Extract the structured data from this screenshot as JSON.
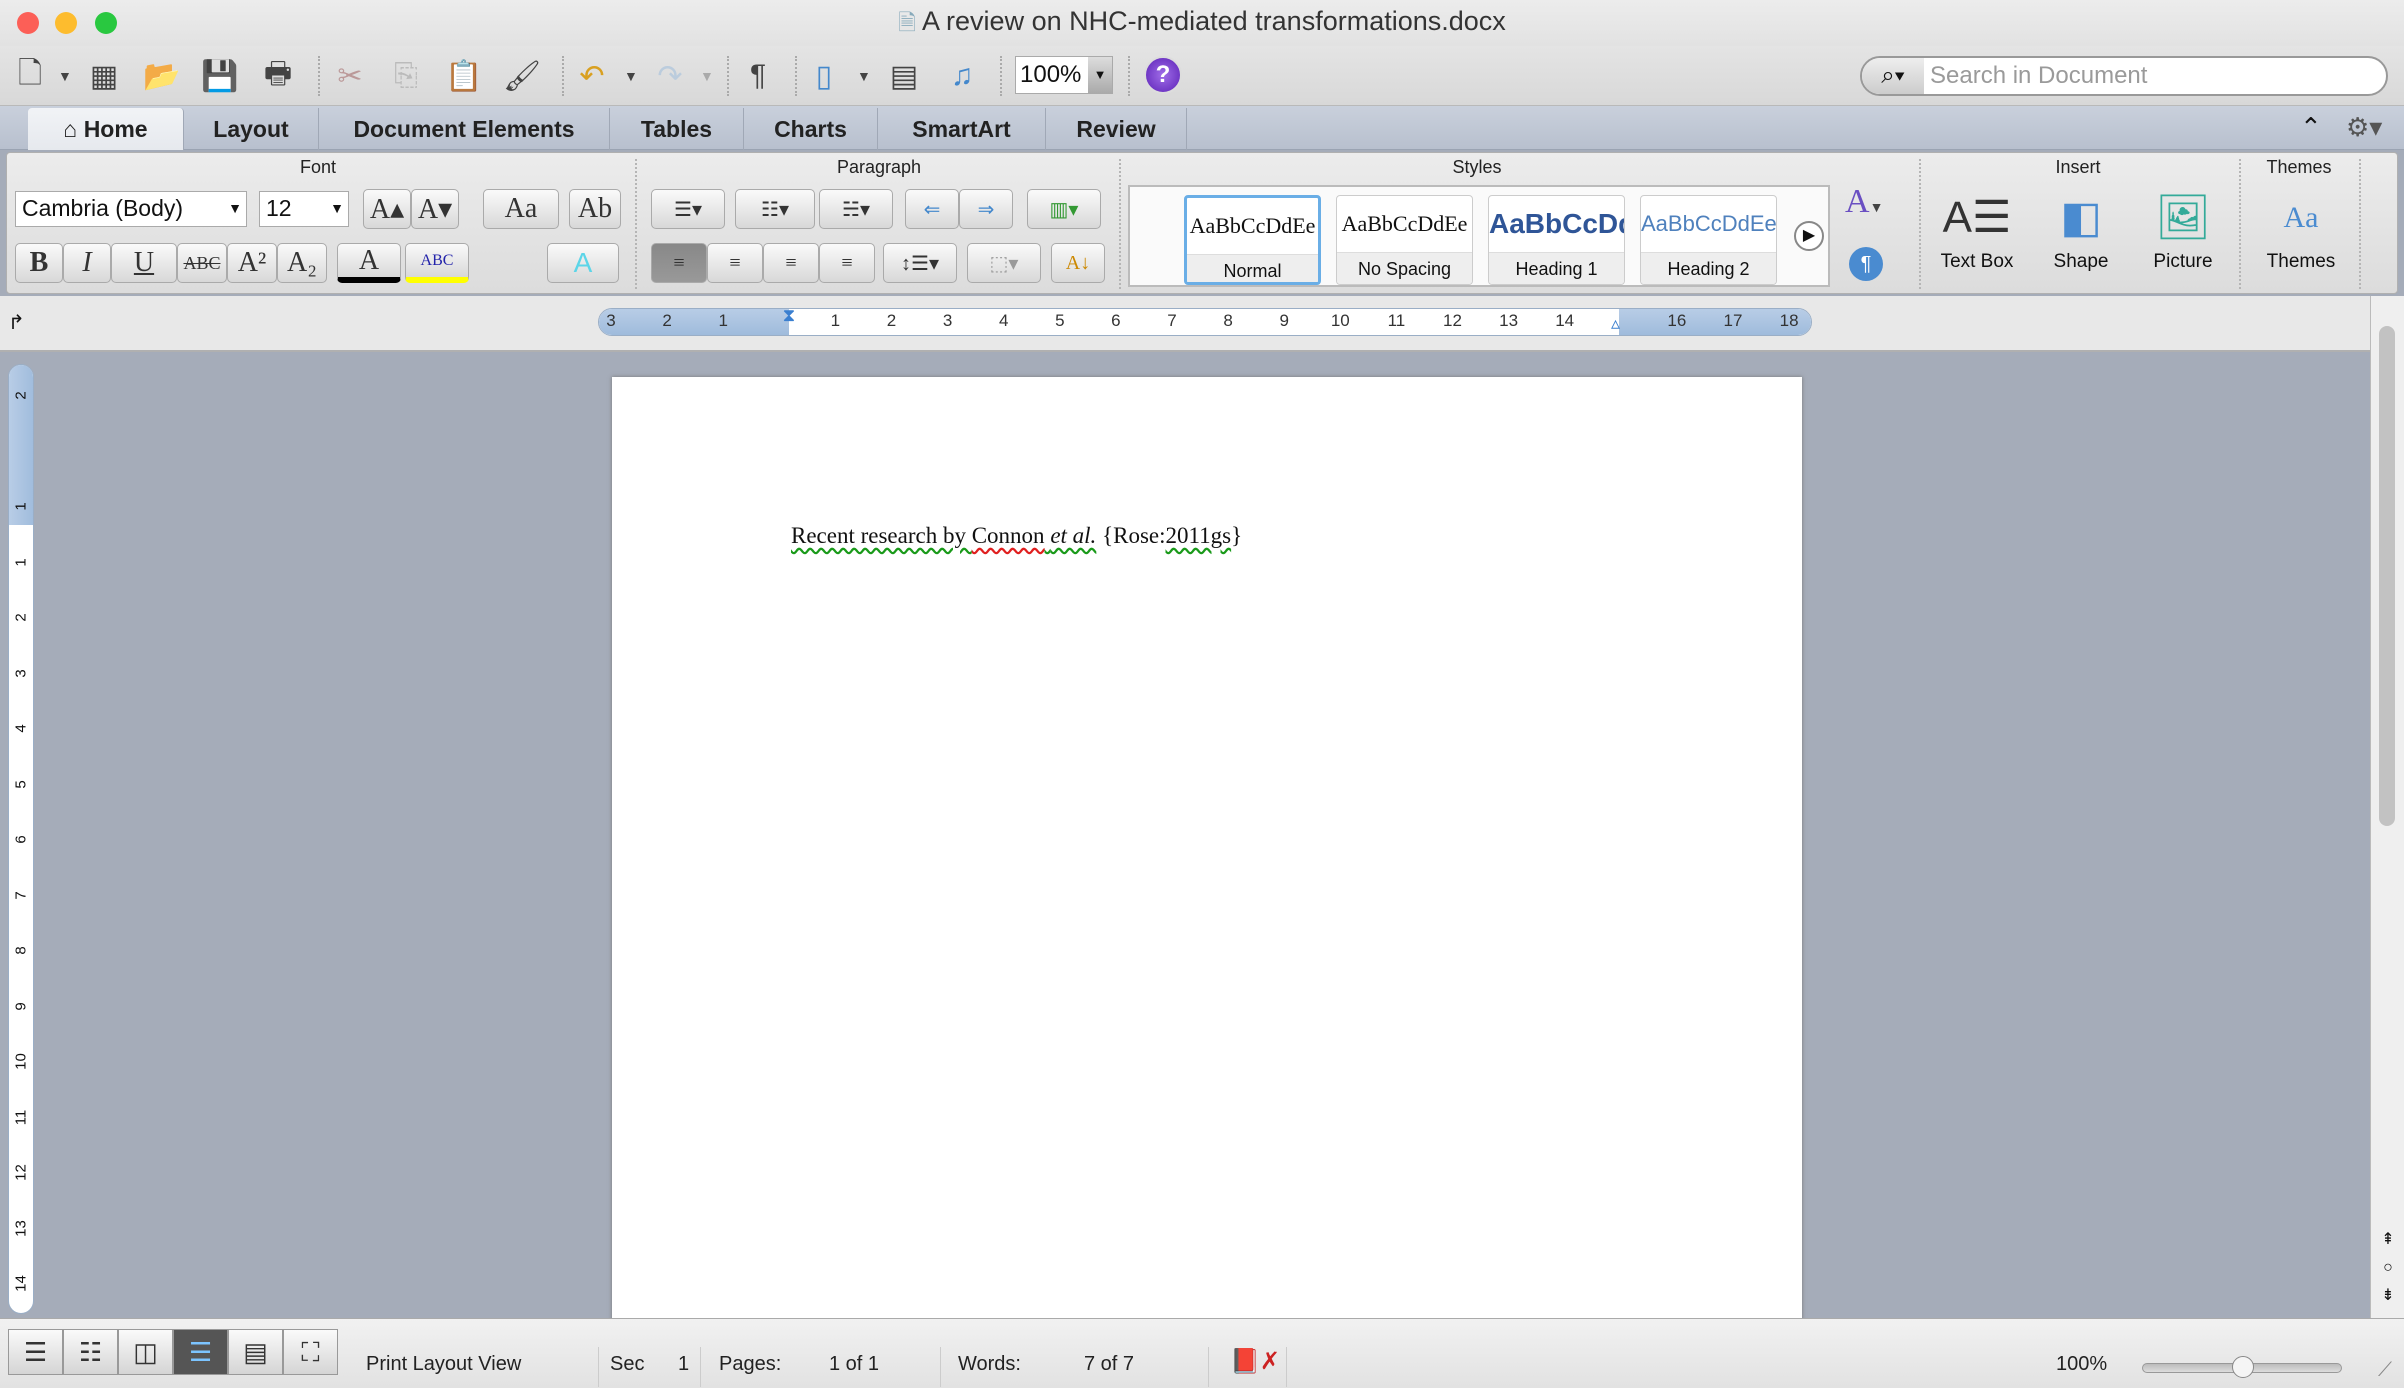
{
  "window": {
    "title": "A review on NHC-mediated transformations.docx"
  },
  "toolbar": {
    "zoom": "100%",
    "help": "?",
    "search_placeholder": "Search in Document"
  },
  "tabs": [
    {
      "label": "Home"
    },
    {
      "label": "Layout"
    },
    {
      "label": "Document Elements"
    },
    {
      "label": "Tables"
    },
    {
      "label": "Charts"
    },
    {
      "label": "SmartArt"
    },
    {
      "label": "Review"
    }
  ],
  "ribbon": {
    "font": {
      "label": "Font",
      "name": "Cambria (Body)",
      "size": "12",
      "bold": "B",
      "italic": "I",
      "underline": "U",
      "strike": "ABC",
      "superscript": "A²",
      "subscript": "A₂",
      "highlight": "ABC",
      "font_color": "A",
      "effects": "A",
      "grow": "A▴",
      "shrink": "A▾",
      "case": "Aa",
      "clear": "Ab",
      "font_color_value": "#000000",
      "highlight_value": "#ffff00"
    },
    "paragraph": {
      "label": "Paragraph"
    },
    "styles": {
      "label": "Styles",
      "items": [
        {
          "preview": "AaBbCcDdEe",
          "name": "Normal",
          "color": "#222222"
        },
        {
          "preview": "AaBbCcDdEe",
          "name": "No Spacing",
          "color": "#222222"
        },
        {
          "preview": "AaBbCcDd",
          "name": "Heading 1",
          "color": "#2f5597"
        },
        {
          "preview": "AaBbCcDdEe",
          "name": "Heading 2",
          "color": "#4f81bd"
        }
      ],
      "selected": "Normal"
    },
    "insert": {
      "label": "Insert",
      "items": [
        {
          "name": "Text Box"
        },
        {
          "name": "Shape"
        },
        {
          "name": "Picture"
        }
      ]
    },
    "themes": {
      "label": "Themes",
      "button": "Themes",
      "preview": "Aa"
    }
  },
  "ruler": {
    "labels": [
      "3",
      "2",
      "1",
      "1",
      "2",
      "3",
      "4",
      "5",
      "6",
      "7",
      "8",
      "9",
      "10",
      "11",
      "12",
      "13",
      "14",
      "16",
      "17",
      "18"
    ],
    "vlabels": [
      "2",
      "1",
      "1",
      "2",
      "3",
      "4",
      "5",
      "6",
      "7",
      "8",
      "9",
      "10",
      "11",
      "12",
      "13",
      "14"
    ]
  },
  "document": {
    "text_part1": "Recent research by ",
    "text_part2": "Connon",
    "text_part3": " ",
    "text_italic": "et al.",
    "text_part4": "  {Rose:",
    "text_part5": "2011gs",
    "text_part6": "}"
  },
  "status": {
    "view": "Print Layout View",
    "sec_label": "Sec",
    "sec": "1",
    "pages_label": "Pages:",
    "pages": "1 of 1",
    "words_label": "Words:",
    "words": "7 of 7",
    "zoom": "100%",
    "zoom_level": 100
  }
}
